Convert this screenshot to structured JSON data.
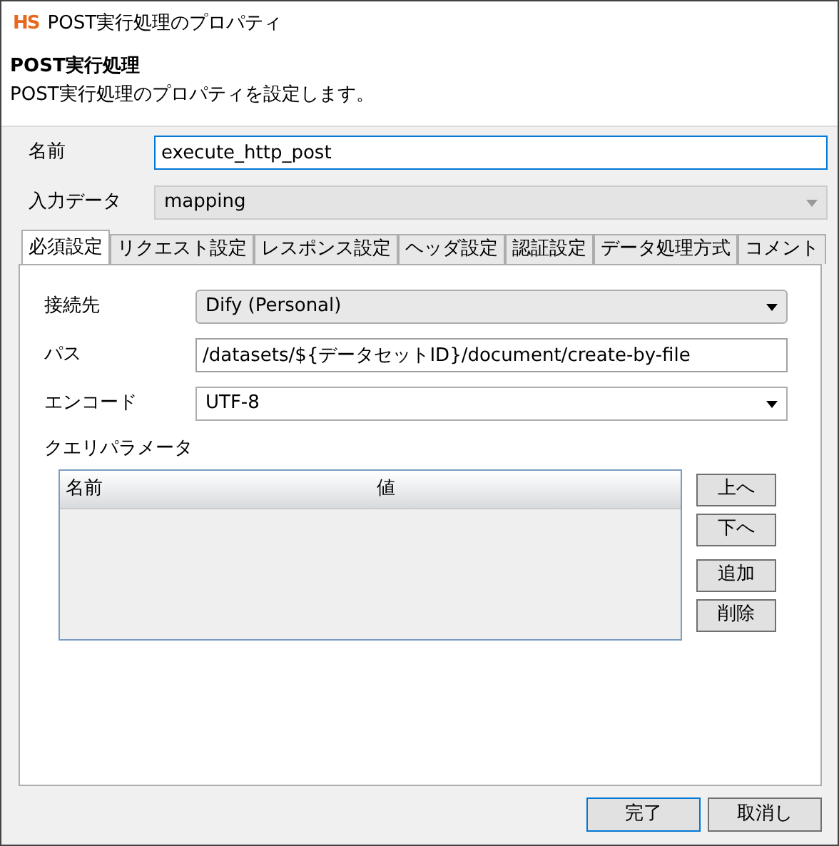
{
  "window": {
    "logo": "HS",
    "title": "POST実行処理のプロパティ"
  },
  "header": {
    "title": "POST実行処理",
    "description": "POST実行処理のプロパティを設定します。"
  },
  "fields": [
    {
      "label": "名前",
      "kind": "text",
      "value": "execute_http_post",
      "focused": true,
      "disabled": false
    },
    {
      "label": "入力データ",
      "kind": "select",
      "value": "mapping",
      "focused": false,
      "disabled": true
    }
  ],
  "tabs": [
    {
      "label": "必須設定",
      "selected": true
    },
    {
      "label": "リクエスト設定",
      "selected": false
    },
    {
      "label": "レスポンス設定",
      "selected": false
    },
    {
      "label": "ヘッダ設定",
      "selected": false
    },
    {
      "label": "認証設定",
      "selected": false
    },
    {
      "label": "データ処理方式",
      "selected": false
    },
    {
      "label": "コメント",
      "selected": false
    }
  ],
  "tab_panel": {
    "fields": [
      {
        "label": "接続先",
        "kind": "select",
        "value": "Dify (Personal)"
      },
      {
        "label": "パス",
        "kind": "text",
        "value": "/datasets/${データセットID}/document/create-by-file"
      },
      {
        "label": "エンコード",
        "kind": "select",
        "value": "UTF-8"
      }
    ],
    "query_parameters": {
      "label": "クエリパラメータ",
      "columns": [
        "名前",
        "値"
      ],
      "buttons": [
        "上へ",
        "下へ",
        "追加",
        "削除"
      ]
    }
  },
  "buttons": [
    {
      "label": "完了",
      "default": true
    },
    {
      "label": "取消し",
      "default": false
    }
  ]
}
